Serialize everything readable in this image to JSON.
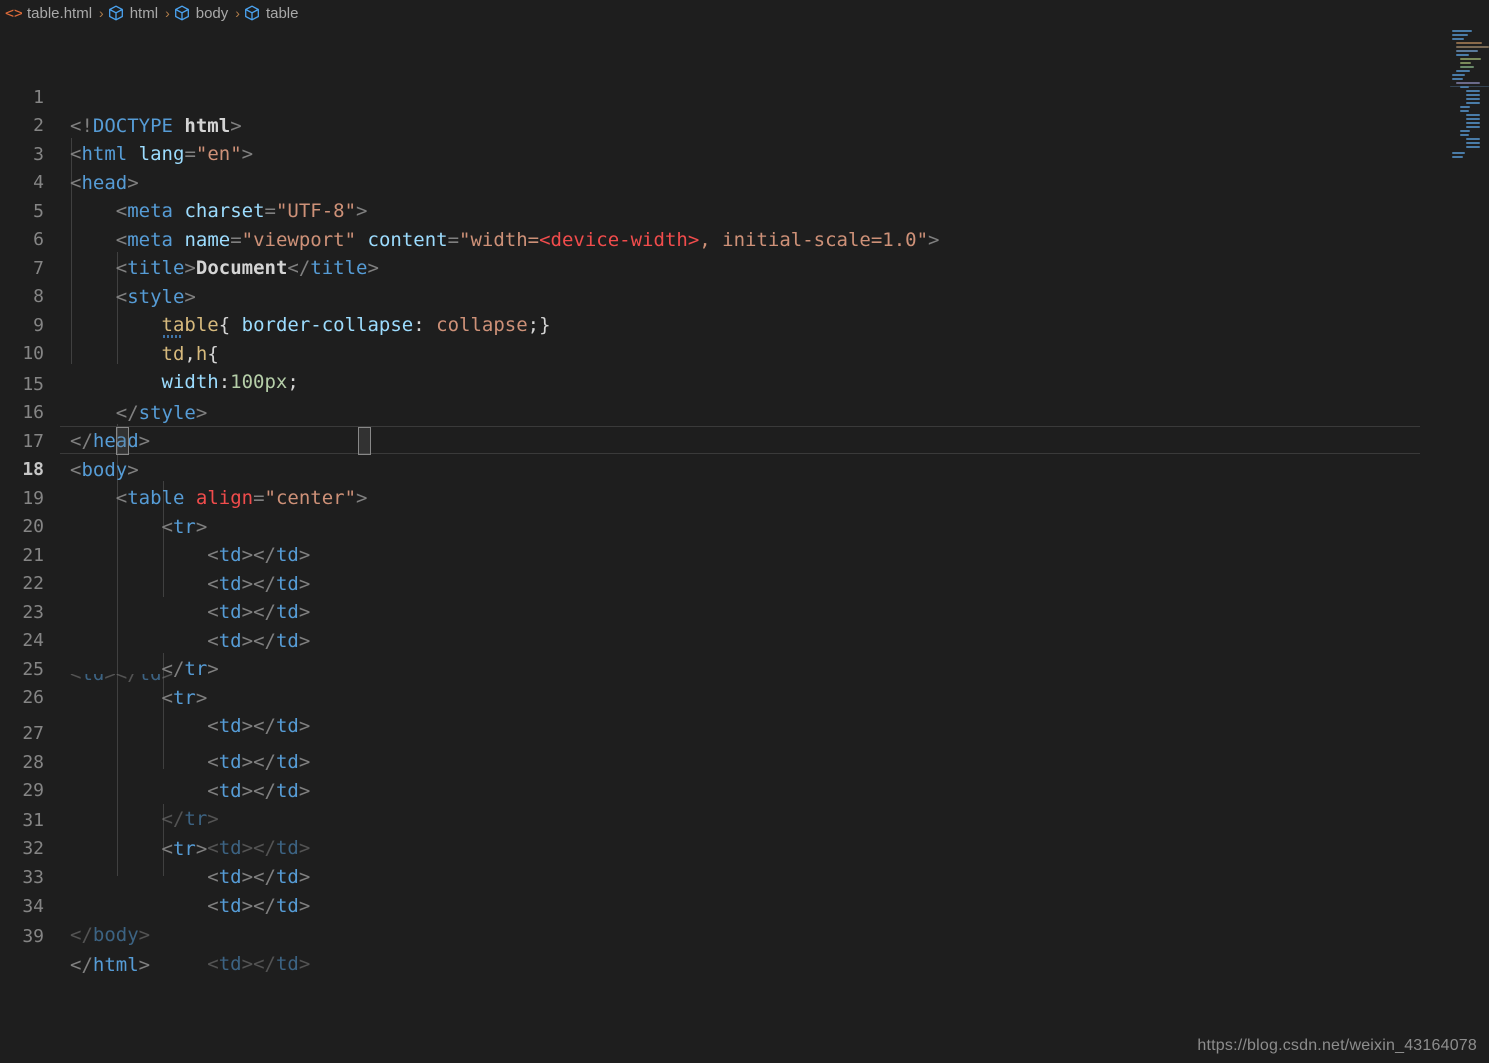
{
  "window": {
    "background": "#1e1e1e",
    "editor_background": "#1e1e1e"
  },
  "breadcrumb": {
    "name": "breadcrumb",
    "separator": "›",
    "items": [
      {
        "icon": "html-file-icon",
        "label": "table.html"
      },
      {
        "icon": "symbol-cube-icon",
        "label": "html"
      },
      {
        "icon": "symbol-cube-icon",
        "label": "body"
      },
      {
        "icon": "symbol-cube-icon",
        "label": "table"
      }
    ]
  },
  "editor": {
    "language": "html",
    "file_name": "table.html",
    "active_line": 18,
    "line_numbers": [
      "1",
      "2",
      "3",
      "4",
      "5",
      "6",
      "7",
      "8",
      "9",
      "10",
      "15",
      "16",
      "17",
      "18",
      "19",
      "20",
      "21",
      "22",
      "23",
      "24",
      "25",
      "26",
      "27",
      "28",
      "29",
      "31",
      "32",
      "33",
      "34",
      "39"
    ],
    "lines": [
      {
        "n": "1",
        "text": "<!DOCTYPE html>"
      },
      {
        "n": "2",
        "text": "<html lang=\"en\">"
      },
      {
        "n": "3",
        "text": "<head>"
      },
      {
        "n": "4",
        "text": "    <meta charset=\"UTF-8\">"
      },
      {
        "n": "5",
        "text": "    <meta name=\"viewport\" content=\"width=<device-width>, initial-scale=1.0\">"
      },
      {
        "n": "6",
        "text": "    <title>Document</title>"
      },
      {
        "n": "7",
        "text": "    <style>"
      },
      {
        "n": "8",
        "text": "        table{ border-collapse: collapse;}"
      },
      {
        "n": "9",
        "text": "        td,h{"
      },
      {
        "n": "10",
        "text": "        width:100px;"
      },
      {
        "n": "15",
        "text": "    </style>"
      },
      {
        "n": "16",
        "text": "</head>"
      },
      {
        "n": "17",
        "text": "<body>"
      },
      {
        "n": "18",
        "text": "    <table align=\"center\">"
      },
      {
        "n": "19",
        "text": "        <tr>"
      },
      {
        "n": "20",
        "text": "            <td></td>"
      },
      {
        "n": "21",
        "text": "            <td></td>"
      },
      {
        "n": "22",
        "text": "            <td></td>"
      },
      {
        "n": "23",
        "text": "            <td></td>"
      },
      {
        "n": "24",
        "text": "        </tr>"
      },
      {
        "n": "25",
        "text": "        <tr>"
      },
      {
        "n": "26",
        "text": "            <td></td>"
      },
      {
        "n": "27",
        "text": "            <td></td>"
      },
      {
        "n": "28",
        "text": "            <td></td>"
      },
      {
        "n": "29",
        "text": "            <td></td>"
      },
      {
        "n": "31",
        "text": "        <tr>"
      },
      {
        "n": "32",
        "text": "            <td></td>"
      },
      {
        "n": "33",
        "text": "            <td></td>"
      },
      {
        "n": "34",
        "text": "            <td></td>"
      },
      {
        "n": "39",
        "text": "</html>"
      }
    ],
    "tear_artifacts": {
      "row_26_ghost": "<td></td>",
      "row_29_ghost": "</tr>",
      "row_34_ghost": "</body>"
    }
  },
  "minimap": {
    "name": "minimap",
    "visible": true
  },
  "watermark": {
    "text": "https://blog.csdn.net/weixin_43164078"
  }
}
